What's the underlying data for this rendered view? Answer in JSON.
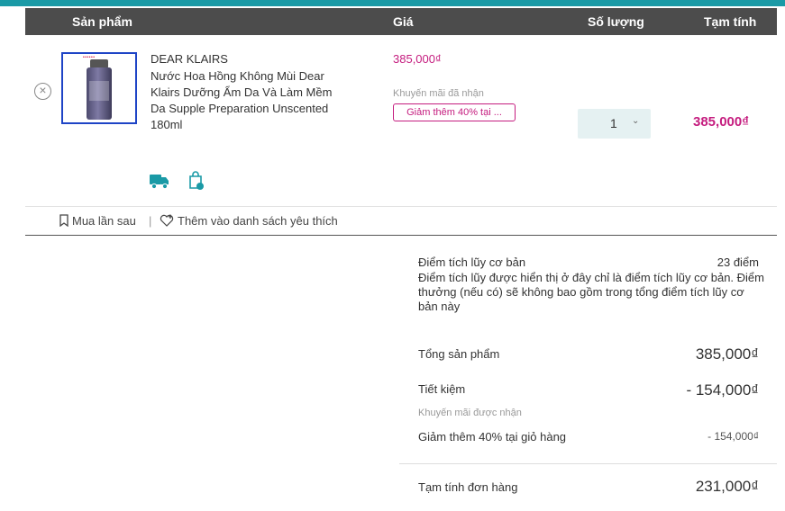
{
  "colors": {
    "accent": "#1a9aa6",
    "header_bg": "#4c4c4c",
    "price": "#c51d7f",
    "qty_bg": "#e5f1f2"
  },
  "table_header": {
    "product": "Sản phẩm",
    "price": "Giá",
    "quantity": "Số lượng",
    "subtotal": "Tạm tính"
  },
  "item": {
    "brand": "DEAR KLAIRS",
    "name": "Nước Hoa Hồng Không Mùi Dear Klairs Dưỡng Ẩm Da Và Làm Mềm Da Supple Preparation Unscented 180ml",
    "price": "385,000₫",
    "promo_label": "Khuyến mãi đã nhận",
    "promo_badge": "Giảm thêm 40% tại ...",
    "quantity": "1",
    "subtotal": "385,000₫",
    "icons": [
      "remove-icon",
      "truck-icon",
      "shopping-bag-icon"
    ]
  },
  "actions": {
    "buy_later": "Mua lần sau",
    "separator": "|",
    "add_wishlist": "Thêm vào danh sách yêu thích"
  },
  "summary": {
    "points_label": "Điểm tích lũy cơ bản",
    "points_value": "23 điểm",
    "points_note": "Điểm tích lũy được hiển thị ở đây chỉ là điểm tích lũy cơ bản. Điểm thưởng (nếu có) sẽ không bao gồm trong tổng điểm tích lũy cơ bản này",
    "total_label": "Tổng sản phẩm",
    "total_value": "385,000₫",
    "savings_label": "Tiết kiệm",
    "savings_value": "- 154,000₫",
    "promo_received": "Khuyến mãi được nhận",
    "discount_label": "Giảm thêm 40% tại giỏ hàng",
    "discount_value": "- 154,000₫",
    "order_label": "Tạm tính đơn hàng",
    "order_value": "231,000₫"
  }
}
